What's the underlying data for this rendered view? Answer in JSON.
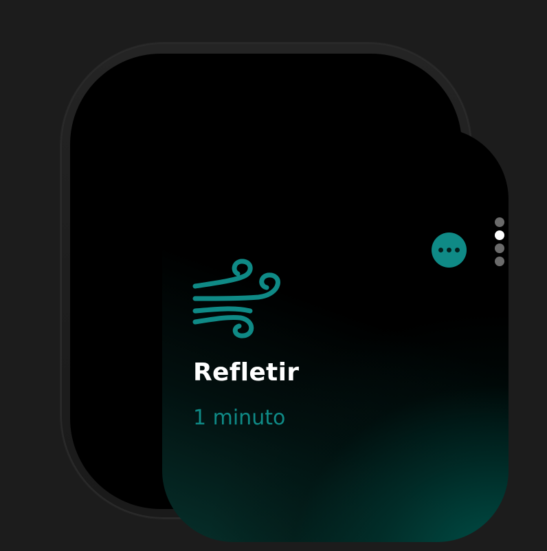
{
  "app": {
    "title": "Refletir",
    "duration": "1 minuto",
    "icon": "wind-icon"
  },
  "controls": {
    "more_icon": "ellipsis-icon"
  },
  "pagination": {
    "total": 4,
    "current": 2
  },
  "colors": {
    "accent": "#0f8a86",
    "background": "#000000",
    "case": "#1c1c1c"
  }
}
